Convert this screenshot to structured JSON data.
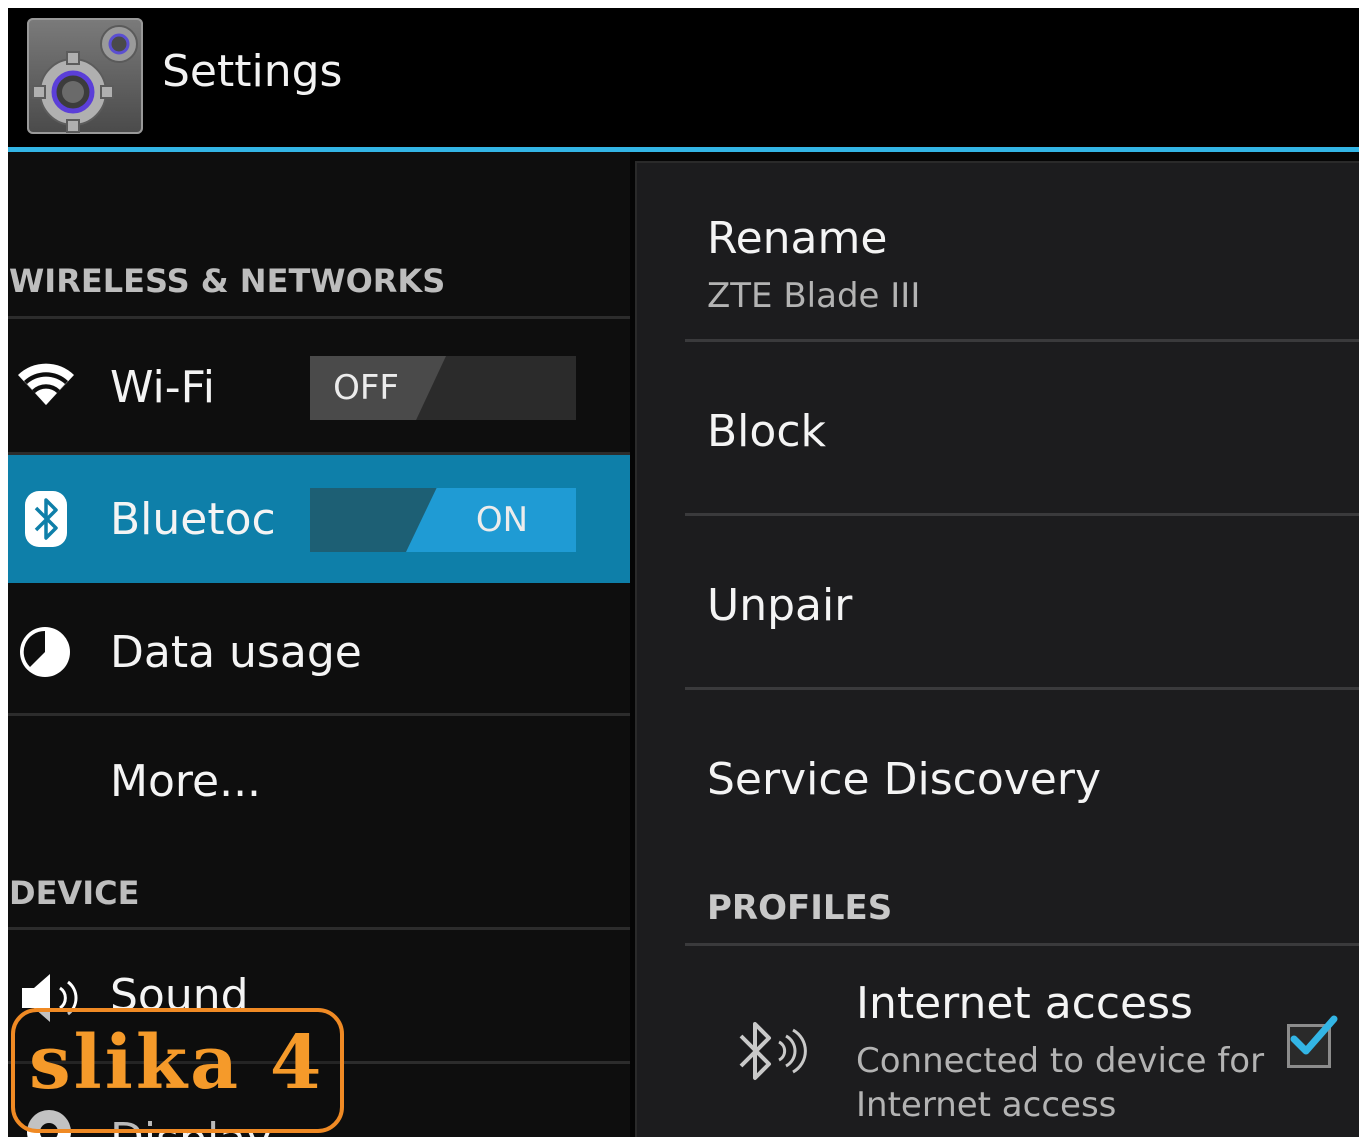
{
  "app": {
    "title": "Settings",
    "icon": "settings-gear-icon"
  },
  "left": {
    "sections": {
      "wireless": "WIRELESS & NETWORKS",
      "device": "DEVICE"
    },
    "items": {
      "wifi": {
        "label": "Wi-Fi",
        "icon": "wifi-icon",
        "toggle": "OFF",
        "on": false
      },
      "bluetooth": {
        "label": "Bluetoc",
        "icon": "bluetooth-icon",
        "toggle": "ON",
        "on": true,
        "selected": true
      },
      "data_usage": {
        "label": "Data usage",
        "icon": "data-usage-icon"
      },
      "more": {
        "label": "More..."
      },
      "sound": {
        "label": "Sound",
        "icon": "speaker-icon"
      },
      "display": {
        "label": "Display",
        "icon": "display-gear-icon"
      }
    }
  },
  "right": {
    "rename": {
      "title": "Rename",
      "subtitle": "ZTE Blade III"
    },
    "block": {
      "title": "Block"
    },
    "unpair": {
      "title": "Unpair"
    },
    "service_discovery": {
      "title": "Service Discovery"
    },
    "profiles_header": "PROFILES",
    "internet_access": {
      "title": "Internet access",
      "subtitle_line1": "Connected to device for",
      "subtitle_line2": "Internet access",
      "checked": true,
      "icon": "bluetooth-signal-icon"
    }
  },
  "overlay": {
    "stamp": "slika 4"
  },
  "colors": {
    "accent": "#33b5e5",
    "selected_row": "#0e7fa9",
    "stamp": "#f08a24"
  }
}
